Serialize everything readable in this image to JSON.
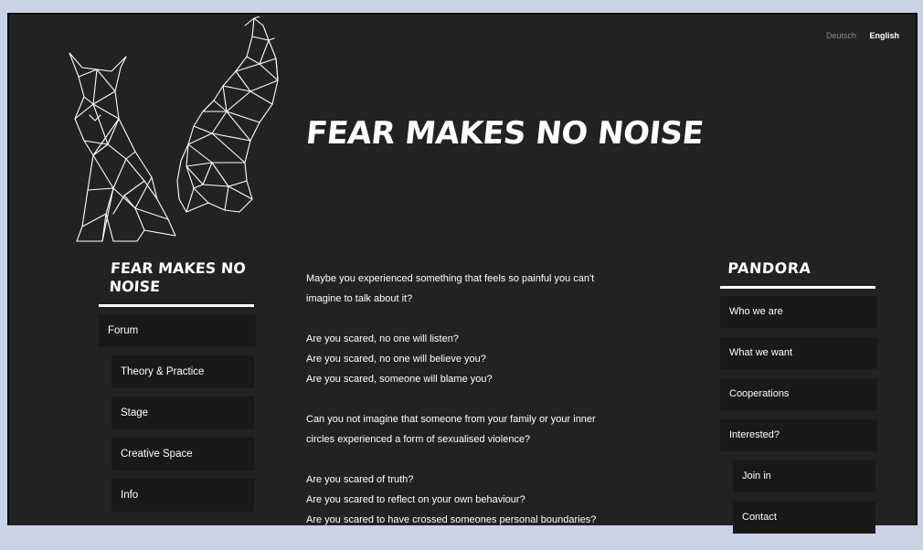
{
  "language": {
    "deutsch": "Deutsch",
    "english": "English"
  },
  "header": {
    "title": "FEAR MAKES NO NOISE"
  },
  "left_sidebar": {
    "title": "FEAR MAKES NO NOISE",
    "items": [
      {
        "label": "Forum",
        "level": 0
      },
      {
        "label": "Theory & Practice",
        "level": 1
      },
      {
        "label": "Stage",
        "level": 1
      },
      {
        "label": "Creative Space",
        "level": 1
      },
      {
        "label": "Info",
        "level": 1
      }
    ]
  },
  "content": {
    "paragraphs": [
      [
        "Maybe you experienced something that feels so painful you can't",
        "imagine to talk about it?"
      ],
      [
        "Are you scared, no one will listen?",
        "Are you scared, no one will believe you?",
        "Are you scared, someone will blame you?"
      ],
      [
        "Can you not imagine that someone from your family or your inner",
        "circles experienced a form of sexualised violence?"
      ],
      [
        "Are you scared of truth?",
        "Are you scared to reflect on your own behaviour?",
        "Are you scared to have crossed someones personal boundaries?"
      ]
    ]
  },
  "right_sidebar": {
    "title": "PANDORA",
    "items": [
      {
        "label": "Who we are",
        "level": 0
      },
      {
        "label": "What we want",
        "level": 0
      },
      {
        "label": "Cooperations",
        "level": 0
      },
      {
        "label": "Interested?",
        "level": 0
      },
      {
        "label": "Join in",
        "level": 1
      },
      {
        "label": "Contact",
        "level": 1
      }
    ]
  },
  "colors": {
    "background": "#222222",
    "nav_background": "#191919",
    "text": "#ffffff",
    "outer": "#c9d3e6"
  },
  "icons": {
    "logo": "geometric-wolves-logo-icon"
  }
}
